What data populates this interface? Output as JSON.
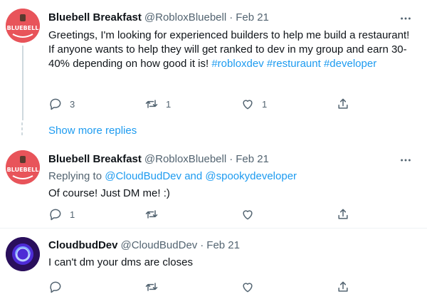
{
  "tweets": [
    {
      "name": "Bluebell Breakfast",
      "handle": "@RobloxBluebell",
      "separator": "·",
      "date": "Feb 21",
      "avatar_text": "BLUEBELL",
      "text_plain": "Greetings, I'm looking for experienced builders to help me build a restaurant! If anyone wants to help they will get ranked to dev in my group and earn 30-40% depending on how good it is!",
      "hashtags": [
        "#robloxdev",
        "#resturaunt",
        "#developer"
      ],
      "reply_count": "3",
      "retweet_count": "1",
      "like_count": "1"
    },
    {
      "name": "Bluebell Breakfast",
      "handle": "@RobloxBluebell",
      "separator": "·",
      "date": "Feb 21",
      "avatar_text": "BLUEBELL",
      "replying_prefix": "Replying to",
      "replying_to_1": "@CloudBudDev",
      "replying_and": "and",
      "replying_to_2": "@spookydeveloper",
      "text": "Of course! Just DM me! :)",
      "reply_count": "1"
    },
    {
      "name": "CloudbudDev",
      "handle": "@CloudBudDev",
      "separator": "·",
      "date": "Feb 21",
      "text": "I can't dm your dms are closes"
    }
  ],
  "show_more_replies": "Show more replies",
  "colors": {
    "link": "#1d9bf0",
    "secondary_text": "#536471",
    "thread_line": "#cfd9de",
    "bluebell_avatar": "#e8545a",
    "cloudbud_avatar": "#2a0f5c"
  },
  "icons": [
    "more-icon",
    "reply-icon",
    "retweet-icon",
    "like-icon",
    "share-icon"
  ]
}
